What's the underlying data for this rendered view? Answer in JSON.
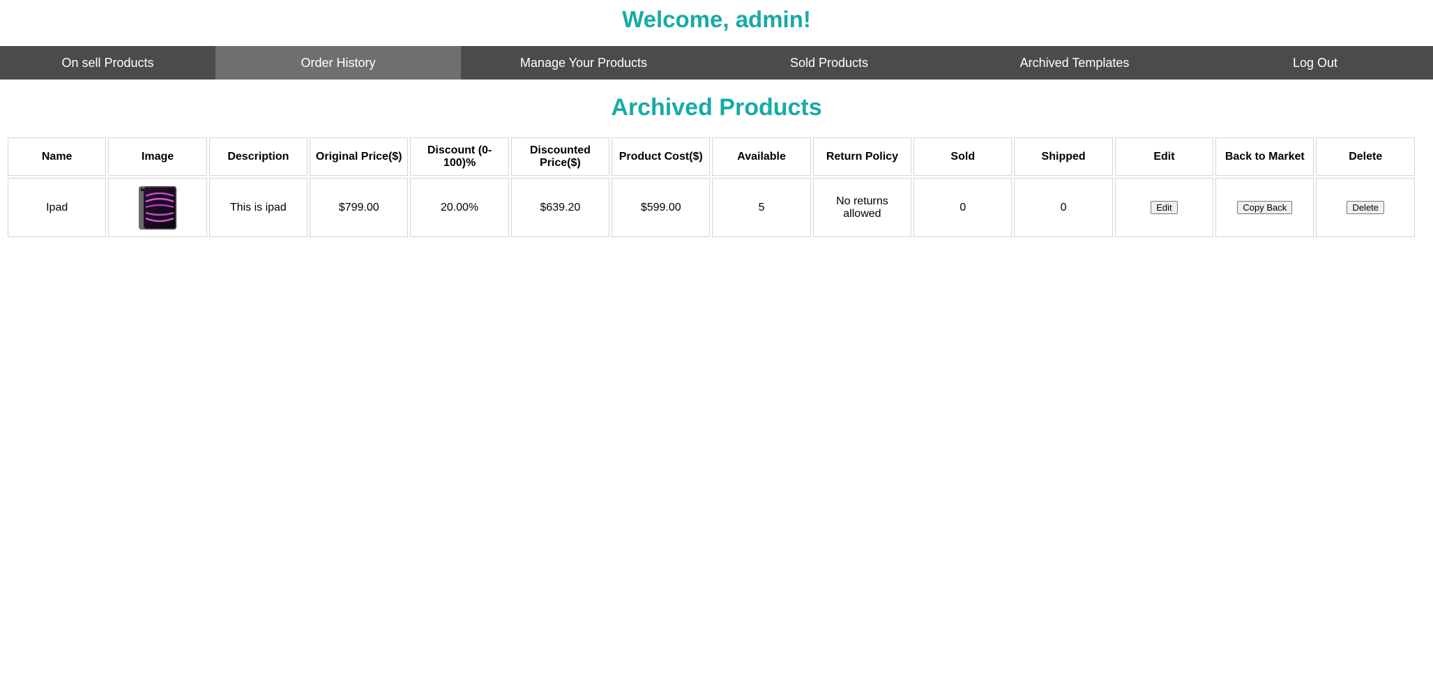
{
  "welcome": "Welcome, admin!",
  "nav": {
    "items": [
      {
        "label": "On sell Products"
      },
      {
        "label": "Order History"
      },
      {
        "label": "Manage Your Products"
      },
      {
        "label": "Sold Products"
      },
      {
        "label": "Archived Templates"
      },
      {
        "label": "Log Out"
      }
    ],
    "active": "Order History"
  },
  "section_title": "Archived Products",
  "table": {
    "headers": {
      "name": "Name",
      "image": "Image",
      "description": "Description",
      "original_price": "Original Price($)",
      "discount": "Discount (0-100)%",
      "discounted_price": "Discounted Price($)",
      "product_cost": "Product Cost($)",
      "available": "Available",
      "return_policy": "Return Policy",
      "sold": "Sold",
      "shipped": "Shipped",
      "edit": "Edit",
      "back_to_market": "Back to Market",
      "delete": "Delete"
    },
    "rows": [
      {
        "name": "Ipad",
        "image_icon": "ipad-product-image",
        "description": "This is ipad",
        "original_price": "$799.00",
        "discount": "20.00%",
        "discounted_price": "$639.20",
        "product_cost": "$599.00",
        "available": "5",
        "return_policy": "No returns allowed",
        "sold": "0",
        "shipped": "0",
        "edit_label": "Edit",
        "copy_back_label": "Copy Back",
        "delete_label": "Delete"
      }
    ]
  },
  "colors": {
    "accent": "#17aaa7",
    "nav_bg": "#4b4b4b",
    "nav_active_bg": "#6f6f6f",
    "discounted_price": "#e0140f"
  }
}
